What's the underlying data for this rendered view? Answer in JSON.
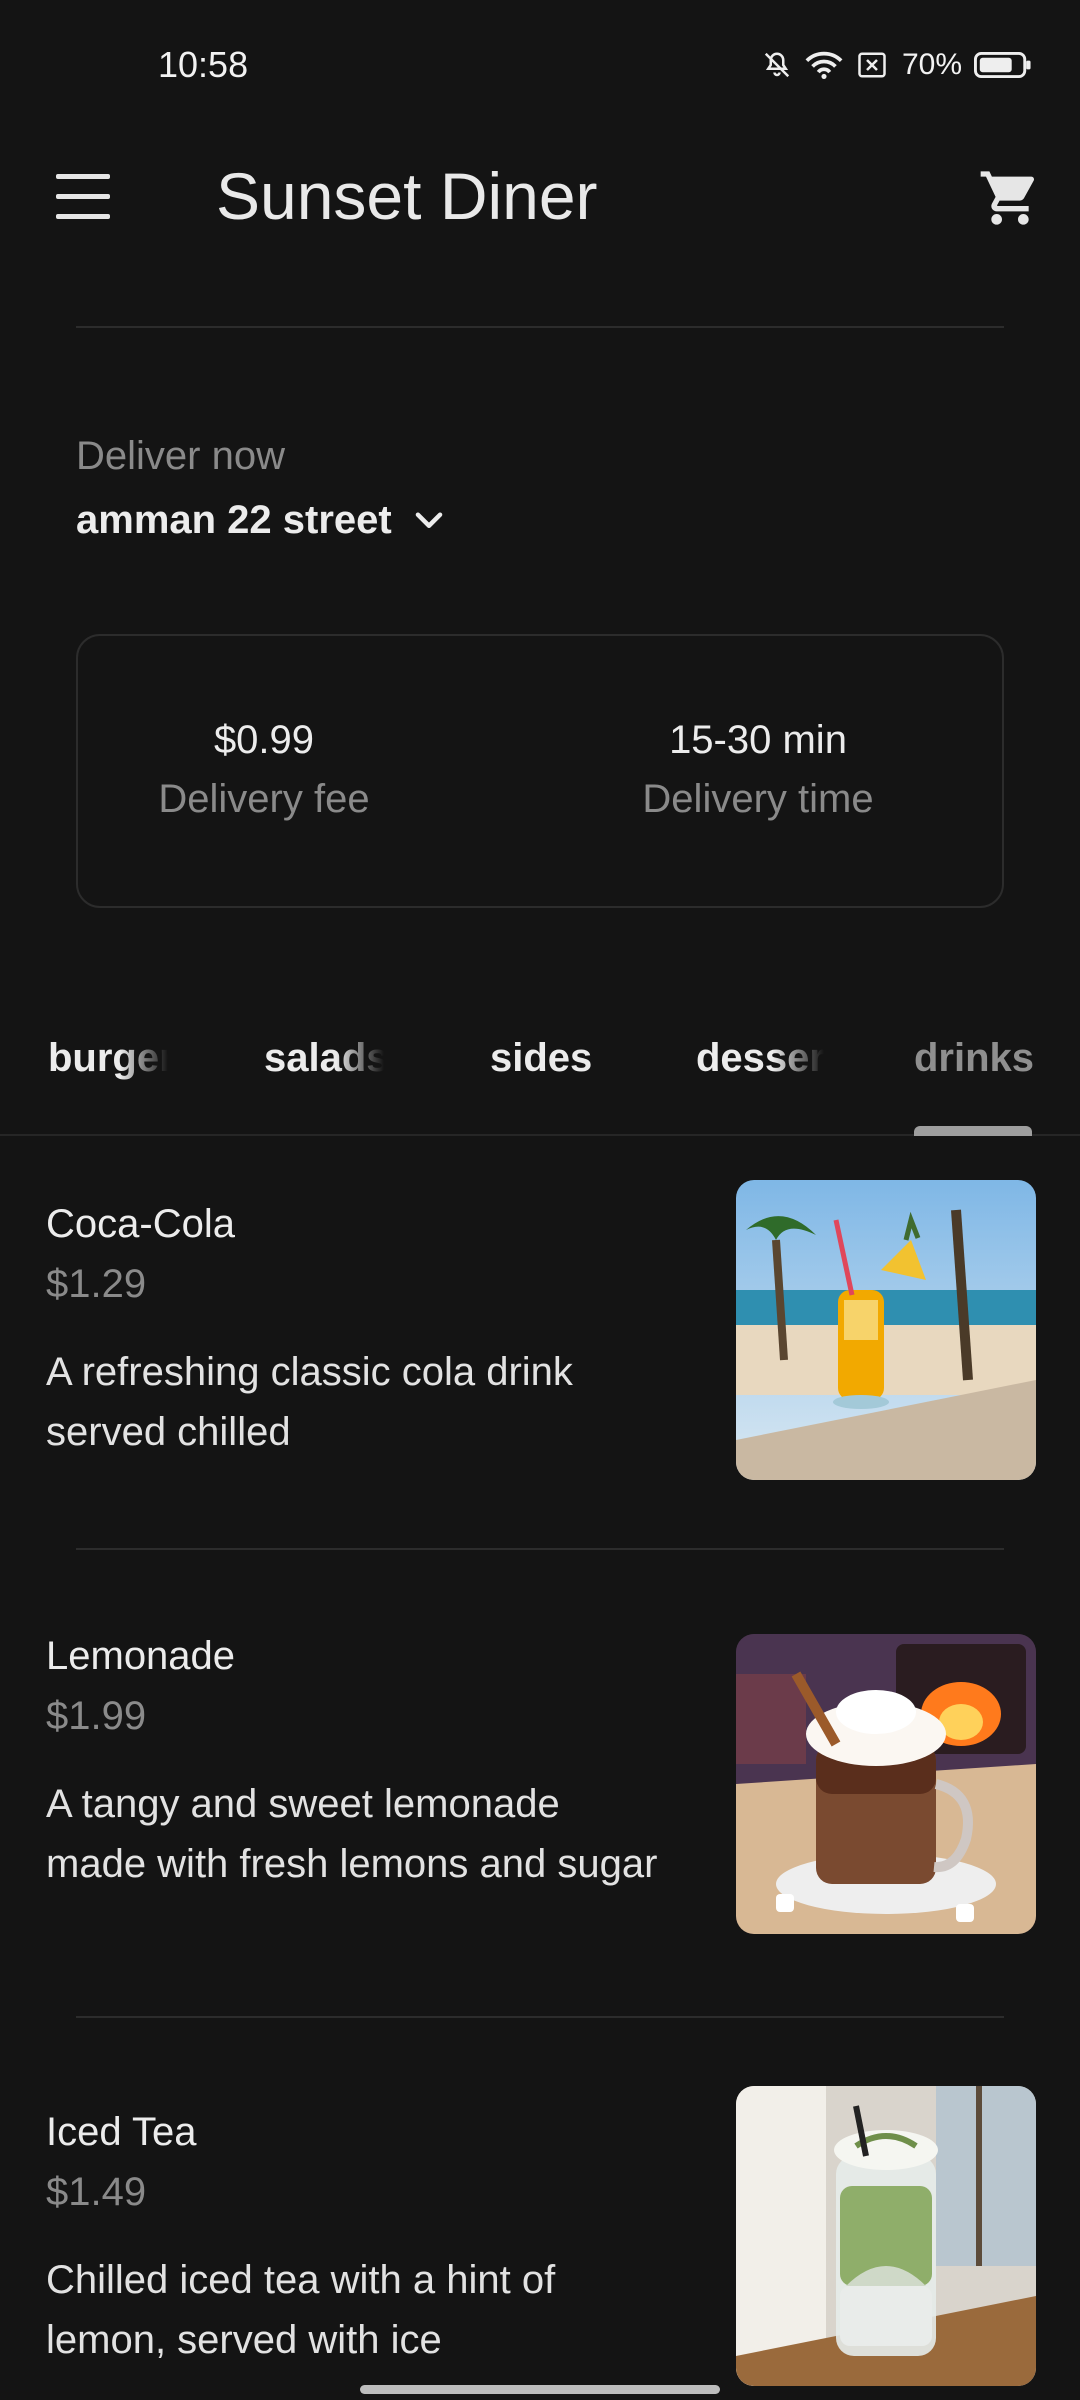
{
  "status": {
    "time": "10:58",
    "battery": "70%",
    "icons": [
      "bell-off-icon",
      "wifi-icon",
      "close-box-icon",
      "battery-icon"
    ]
  },
  "appbar": {
    "title": "Sunset Diner",
    "menu_icon": "hamburger-menu-icon",
    "cart_icon": "cart-icon"
  },
  "delivery": {
    "label": "Deliver now",
    "address": "amman 22 street",
    "fee_value": "$0.99",
    "fee_label": "Delivery fee",
    "time_value": "15-30 min",
    "time_label": "Delivery time"
  },
  "tabs": [
    {
      "label": "burgers"
    },
    {
      "label": "salads"
    },
    {
      "label": "sides"
    },
    {
      "label": "desserts"
    },
    {
      "label": "drinks",
      "active": true
    }
  ],
  "items": [
    {
      "name": "Coca-Cola",
      "price": "$1.29",
      "description": "A refreshing classic cola drink served chilled",
      "image": "tropical-smoothie-beach-photo"
    },
    {
      "name": "Lemonade",
      "price": "$1.99",
      "description": "A tangy and sweet lemonade made with fresh lemons and sugar",
      "image": "hot-chocolate-fireplace-photo"
    },
    {
      "name": "Iced Tea",
      "price": "$1.49",
      "description": "Chilled iced tea with a hint of lemon, served with ice",
      "image": "matcha-latte-photo"
    }
  ],
  "colors": {
    "background": "#141414",
    "text": "#ececec",
    "muted": "#8a8a8a",
    "divider": "#2c2c2c"
  }
}
